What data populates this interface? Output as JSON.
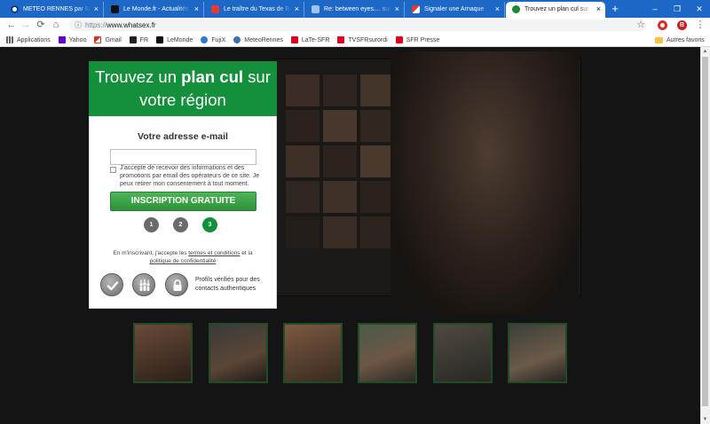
{
  "browser": {
    "theme_color": "#1d68c6",
    "tabs": [
      {
        "title": "METEO RENNES par Météo-",
        "favicon": "meteo-favicon"
      },
      {
        "title": "Le Monde.fr - Actualités et I",
        "favicon": "lemonde-favicon"
      },
      {
        "title": "Le traître du Texas de Bush",
        "favicon": "news-favicon"
      },
      {
        "title": "Re: between eyes.... surprise",
        "favicon": "mail-favicon"
      },
      {
        "title": "Signaler une Arnaque",
        "favicon": "report-favicon"
      },
      {
        "title": "Trouvez un plan cul sur votre",
        "favicon": "site-favicon"
      }
    ],
    "tab_close": "×",
    "new_tab_label": "+",
    "window_controls": {
      "minimize": "–",
      "maximize": "❐",
      "close": "✕"
    },
    "address": {
      "scheme": "https://",
      "host": "www.whatsex.fr"
    },
    "profile_initial": "B",
    "toolbar_icons": [
      "back-icon",
      "forward-icon",
      "reload-icon",
      "home-icon",
      "info-icon",
      "star-icon",
      "extension-icon",
      "menu-icon"
    ],
    "bookmarks": [
      {
        "label": "Applications",
        "icon": "apps-grid-icon",
        "color": "#5f6368"
      },
      {
        "label": "Yahoo",
        "icon": "yahoo-icon",
        "color": "#6001d2"
      },
      {
        "label": "Gmail",
        "icon": "gmail-icon",
        "color": "#d93025"
      },
      {
        "label": "FR",
        "icon": "fr-icon",
        "color": "#202124"
      },
      {
        "label": "LeMonde",
        "icon": "lemonde-icon",
        "color": "#111111"
      },
      {
        "label": "FujiX",
        "icon": "fujix-icon",
        "color": "#2a7bd1"
      },
      {
        "label": "MeteoRennes",
        "icon": "meteo-icon",
        "color": "#3b6fb6"
      },
      {
        "label": "LaTe-SFR",
        "icon": "sfr-icon",
        "color": "#e2001a"
      },
      {
        "label": "TVSFRsurordi",
        "icon": "sfr-tv-icon",
        "color": "#e2001a"
      },
      {
        "label": "SFR Presse",
        "icon": "sfr-presse-icon",
        "color": "#e2001a"
      }
    ],
    "other_bookmarks": "Autres favoris"
  },
  "signup": {
    "title_pre": "Trouvez un ",
    "title_bold": "plan cul",
    "title_line1_end": " sur",
    "title_line2": "votre région",
    "email_label": "Votre adresse e-mail",
    "email_value": "",
    "consent_checked": false,
    "consent_text": "J'accepte de recevoir des informations et des promotions par email des opérateurs de ce site. Je peux retirer mon consentement à tout moment.",
    "submit_label": "INSCRIPTION GRATUITE",
    "steps": [
      "1",
      "2",
      "3"
    ],
    "current_step": 3,
    "terms_pre": "En m'inscrivant, j'accepte les ",
    "terms_link": "termes et conditions",
    "terms_mid": " et la ",
    "privacy_link": "politique de confidentialité",
    "badges": [
      "check-badge-icon",
      "community-badge-icon",
      "lock-badge-icon"
    ],
    "trust_text": "Profils vérifiés pour des contacts authentiques"
  },
  "colors": {
    "brand_green": "#14903c",
    "step_inactive": "#6b6b6b",
    "page_background": "#141414",
    "thumbnail_border": "#1f4c25"
  },
  "profiles": [
    {
      "photo": "profile-photo"
    },
    {
      "photo": "profile-photo"
    },
    {
      "photo": "profile-photo"
    },
    {
      "photo": "profile-photo"
    },
    {
      "photo": "profile-photo"
    },
    {
      "photo": "profile-photo"
    }
  ]
}
